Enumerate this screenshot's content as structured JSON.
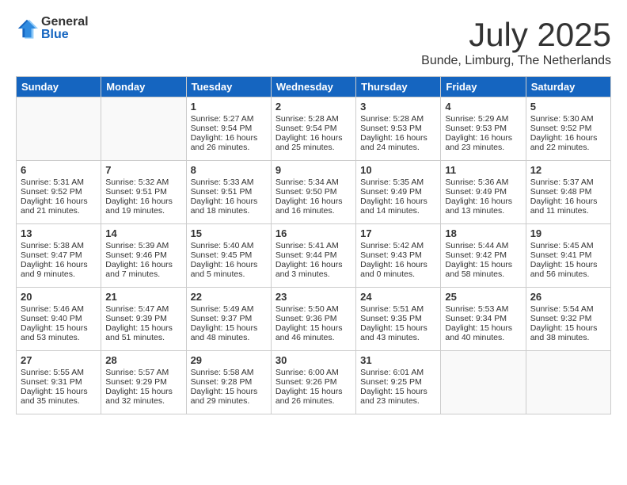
{
  "header": {
    "logo_general": "General",
    "logo_blue": "Blue",
    "month": "July 2025",
    "location": "Bunde, Limburg, The Netherlands"
  },
  "weekdays": [
    "Sunday",
    "Monday",
    "Tuesday",
    "Wednesday",
    "Thursday",
    "Friday",
    "Saturday"
  ],
  "weeks": [
    [
      {
        "day": "",
        "text": ""
      },
      {
        "day": "",
        "text": ""
      },
      {
        "day": "1",
        "text": "Sunrise: 5:27 AM\nSunset: 9:54 PM\nDaylight: 16 hours and 26 minutes."
      },
      {
        "day": "2",
        "text": "Sunrise: 5:28 AM\nSunset: 9:54 PM\nDaylight: 16 hours and 25 minutes."
      },
      {
        "day": "3",
        "text": "Sunrise: 5:28 AM\nSunset: 9:53 PM\nDaylight: 16 hours and 24 minutes."
      },
      {
        "day": "4",
        "text": "Sunrise: 5:29 AM\nSunset: 9:53 PM\nDaylight: 16 hours and 23 minutes."
      },
      {
        "day": "5",
        "text": "Sunrise: 5:30 AM\nSunset: 9:52 PM\nDaylight: 16 hours and 22 minutes."
      }
    ],
    [
      {
        "day": "6",
        "text": "Sunrise: 5:31 AM\nSunset: 9:52 PM\nDaylight: 16 hours and 21 minutes."
      },
      {
        "day": "7",
        "text": "Sunrise: 5:32 AM\nSunset: 9:51 PM\nDaylight: 16 hours and 19 minutes."
      },
      {
        "day": "8",
        "text": "Sunrise: 5:33 AM\nSunset: 9:51 PM\nDaylight: 16 hours and 18 minutes."
      },
      {
        "day": "9",
        "text": "Sunrise: 5:34 AM\nSunset: 9:50 PM\nDaylight: 16 hours and 16 minutes."
      },
      {
        "day": "10",
        "text": "Sunrise: 5:35 AM\nSunset: 9:49 PM\nDaylight: 16 hours and 14 minutes."
      },
      {
        "day": "11",
        "text": "Sunrise: 5:36 AM\nSunset: 9:49 PM\nDaylight: 16 hours and 13 minutes."
      },
      {
        "day": "12",
        "text": "Sunrise: 5:37 AM\nSunset: 9:48 PM\nDaylight: 16 hours and 11 minutes."
      }
    ],
    [
      {
        "day": "13",
        "text": "Sunrise: 5:38 AM\nSunset: 9:47 PM\nDaylight: 16 hours and 9 minutes."
      },
      {
        "day": "14",
        "text": "Sunrise: 5:39 AM\nSunset: 9:46 PM\nDaylight: 16 hours and 7 minutes."
      },
      {
        "day": "15",
        "text": "Sunrise: 5:40 AM\nSunset: 9:45 PM\nDaylight: 16 hours and 5 minutes."
      },
      {
        "day": "16",
        "text": "Sunrise: 5:41 AM\nSunset: 9:44 PM\nDaylight: 16 hours and 3 minutes."
      },
      {
        "day": "17",
        "text": "Sunrise: 5:42 AM\nSunset: 9:43 PM\nDaylight: 16 hours and 0 minutes."
      },
      {
        "day": "18",
        "text": "Sunrise: 5:44 AM\nSunset: 9:42 PM\nDaylight: 15 hours and 58 minutes."
      },
      {
        "day": "19",
        "text": "Sunrise: 5:45 AM\nSunset: 9:41 PM\nDaylight: 15 hours and 56 minutes."
      }
    ],
    [
      {
        "day": "20",
        "text": "Sunrise: 5:46 AM\nSunset: 9:40 PM\nDaylight: 15 hours and 53 minutes."
      },
      {
        "day": "21",
        "text": "Sunrise: 5:47 AM\nSunset: 9:39 PM\nDaylight: 15 hours and 51 minutes."
      },
      {
        "day": "22",
        "text": "Sunrise: 5:49 AM\nSunset: 9:37 PM\nDaylight: 15 hours and 48 minutes."
      },
      {
        "day": "23",
        "text": "Sunrise: 5:50 AM\nSunset: 9:36 PM\nDaylight: 15 hours and 46 minutes."
      },
      {
        "day": "24",
        "text": "Sunrise: 5:51 AM\nSunset: 9:35 PM\nDaylight: 15 hours and 43 minutes."
      },
      {
        "day": "25",
        "text": "Sunrise: 5:53 AM\nSunset: 9:34 PM\nDaylight: 15 hours and 40 minutes."
      },
      {
        "day": "26",
        "text": "Sunrise: 5:54 AM\nSunset: 9:32 PM\nDaylight: 15 hours and 38 minutes."
      }
    ],
    [
      {
        "day": "27",
        "text": "Sunrise: 5:55 AM\nSunset: 9:31 PM\nDaylight: 15 hours and 35 minutes."
      },
      {
        "day": "28",
        "text": "Sunrise: 5:57 AM\nSunset: 9:29 PM\nDaylight: 15 hours and 32 minutes."
      },
      {
        "day": "29",
        "text": "Sunrise: 5:58 AM\nSunset: 9:28 PM\nDaylight: 15 hours and 29 minutes."
      },
      {
        "day": "30",
        "text": "Sunrise: 6:00 AM\nSunset: 9:26 PM\nDaylight: 15 hours and 26 minutes."
      },
      {
        "day": "31",
        "text": "Sunrise: 6:01 AM\nSunset: 9:25 PM\nDaylight: 15 hours and 23 minutes."
      },
      {
        "day": "",
        "text": ""
      },
      {
        "day": "",
        "text": ""
      }
    ]
  ]
}
